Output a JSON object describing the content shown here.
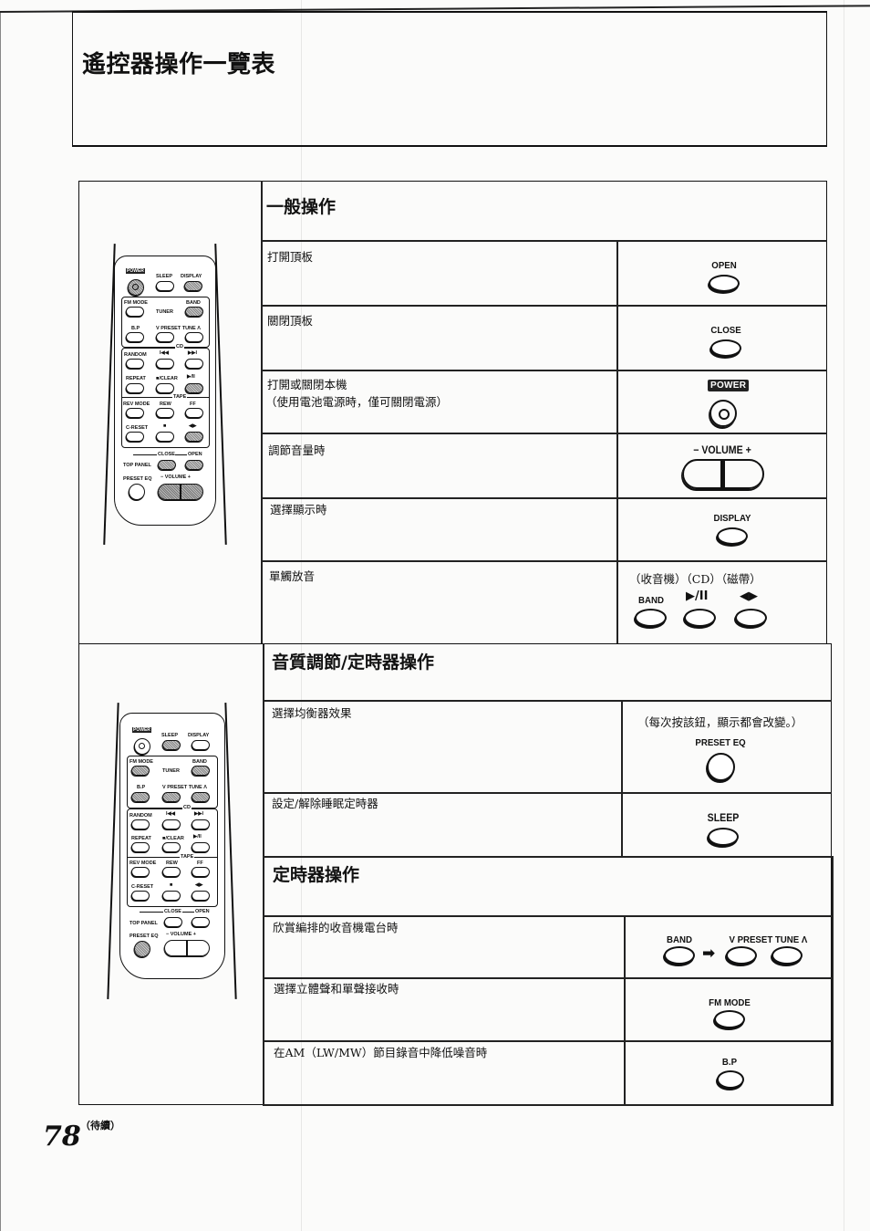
{
  "page": {
    "title": "遙控器操作一覽表",
    "page_number": "78",
    "continued_label": "（待續）"
  },
  "remote": {
    "power": "POWER",
    "sleep": "SLEEP",
    "display": "DISPLAY",
    "fm_mode": "FM MODE",
    "band": "BAND",
    "tuner": "TUNER",
    "bp": "B.P",
    "preset_tune": "V PRESET TUNE Λ",
    "cd": "CD",
    "random": "RANDOM",
    "prev": "I◀◀",
    "next": "▶▶I",
    "repeat": "REPEAT",
    "stop_clear": "■/CLEAR",
    "play_pause": "▶/II",
    "tape": "TAPE",
    "rev_mode": "REV MODE",
    "rew": "REW",
    "ff": "FF",
    "c_reset": "C-RESET",
    "stop": "■",
    "tape_play": "◀▶",
    "close": "CLOSE",
    "open": "OPEN",
    "top_panel": "TOP PANEL",
    "preset_eq": "PRESET EQ",
    "volume": "− VOLUME +"
  },
  "sections": [
    {
      "heading": "一般操作",
      "rows": [
        {
          "text": "打開頂板",
          "buttons": [
            "OPEN"
          ]
        },
        {
          "text": "關閉頂板",
          "buttons": [
            "CLOSE"
          ]
        },
        {
          "text": "打開或關閉本機",
          "subtext": "（使用電池電源時，僅可關閉電源）",
          "buttons": [
            "POWER"
          ]
        },
        {
          "text": "調節音量時",
          "buttons": [
            "− VOLUME +"
          ]
        },
        {
          "text": "選擇顯示時",
          "buttons": [
            "DISPLAY"
          ]
        },
        {
          "text": "單觸放音",
          "note": "（收音機）（CD）（磁帶）",
          "buttons": [
            "BAND",
            "▶/II",
            "◀▶"
          ]
        }
      ]
    },
    {
      "heading": "音質調節/定時器操作",
      "rows": [
        {
          "text": "選擇均衡器效果",
          "note": "（每次按該鈕，顯示都會改變。）",
          "buttons": [
            "PRESET EQ"
          ]
        },
        {
          "text": "設定/解除睡眠定時器",
          "buttons": [
            "SLEEP"
          ]
        }
      ]
    },
    {
      "heading": "定時器操作",
      "rows": [
        {
          "text": "欣賞編排的收音機電台時",
          "buttons": [
            "BAND",
            "V PRESET TUNE Λ"
          ],
          "arrow": "➡"
        },
        {
          "text": "選擇立體聲和單聲接收時",
          "buttons": [
            "FM MODE"
          ]
        },
        {
          "text": "在AM（LW/MW）節目錄音中降低噪音時",
          "buttons": [
            "B.P"
          ]
        }
      ]
    }
  ]
}
